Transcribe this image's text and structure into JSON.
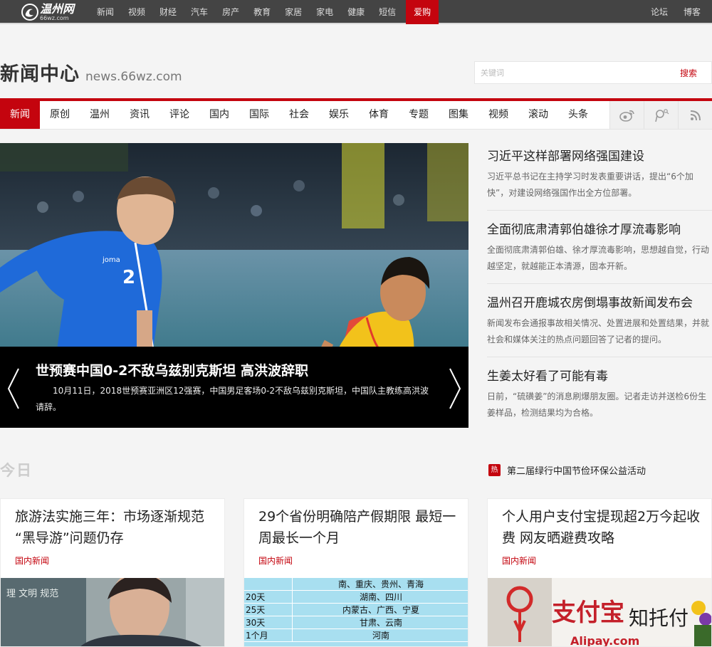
{
  "topbar": {
    "logo_cn": "温州网",
    "logo_en": "66wz.com",
    "nav": [
      "新闻",
      "视频",
      "财经",
      "汽车",
      "房产",
      "教育",
      "家居",
      "家电",
      "健康",
      "短信"
    ],
    "nav_hot": "爱购",
    "right_links": [
      "论坛",
      "博客"
    ]
  },
  "brand": {
    "title": "新闻中心",
    "url": "news.66wz.com"
  },
  "search": {
    "placeholder": "关键词",
    "button": "搜索"
  },
  "mainnav": {
    "items": [
      "新闻",
      "原创",
      "温州",
      "资讯",
      "评论",
      "国内",
      "国际",
      "社会",
      "娱乐",
      "体育",
      "专题",
      "图集",
      "视频",
      "滚动",
      "头条"
    ],
    "active_index": 0,
    "social_icons": [
      "weibo-icon",
      "tencent-weibo-icon",
      "rss-icon"
    ]
  },
  "hero": {
    "player_number": "2",
    "brand_word": "joma",
    "title": "世预赛中国0-2不敌乌兹别克斯坦 高洪波辞职",
    "text": "10月11日，2018世预赛亚洲区12强赛，中国男足客场0-2不敌乌兹别克斯坦，中国队主教练高洪波请辞。"
  },
  "side_news": [
    {
      "title": "习近平这样部署网络强国建设",
      "summary": "习近平总书记在主持学习时发表重要讲话，提出“6个加快”，对建设网络强国作出全方位部署。"
    },
    {
      "title": "全面彻底肃清郭伯雄徐才厚流毒影响",
      "summary": "全面彻底肃清郭伯雄、徐才厚流毒影响，思想越自觉，行动越坚定，就越能正本清源，固本开新。"
    },
    {
      "title": "温州召开鹿城农房倒塌事故新闻发布会",
      "summary": "新闻发布会通报事故相关情况、处置进展和处置结果，并就社会和媒体关注的热点问题回答了记者的提问。"
    },
    {
      "title": "生姜太好看了可能有毒",
      "summary": "日前，“硫磺姜”的消息刷爆朋友圈。记者走访并送检6份生姜样品，检测结果均为合格。"
    }
  ],
  "hot_link": {
    "badge": "热",
    "text": "第二届绿行中国节俭环保公益活动"
  },
  "today_label": "今日",
  "cards": [
    {
      "title": "旅游法实施三年：市场逐渐规范 “黑导游”问题仍存",
      "tag": "国内新闻",
      "thumb_sign": "理 文明 规范"
    },
    {
      "title": "29个省份明确陪产假期限 最短一周最长一个月",
      "tag": "国内新闻",
      "table_rows": [
        {
          "days": "",
          "provinces": "南、重庆、贵州、青海"
        },
        {
          "days": "20天",
          "provinces": "湖南、四川"
        },
        {
          "days": "25天",
          "provinces": "内蒙古、广西、宁夏"
        },
        {
          "days": "30天",
          "provinces": "甘肃、云南"
        },
        {
          "days": "1个月",
          "provinces": "河南"
        }
      ]
    },
    {
      "title": "个人用户支付宝提现超2万今起收费 网友晒避费攻略",
      "tag": "国内新闻",
      "thumb_logo": "支付宝",
      "thumb_logo_en": "Alipay.com",
      "thumb_slogan": "知托付"
    }
  ],
  "colors": {
    "accent": "#c4040e",
    "topbar": "#444444"
  }
}
